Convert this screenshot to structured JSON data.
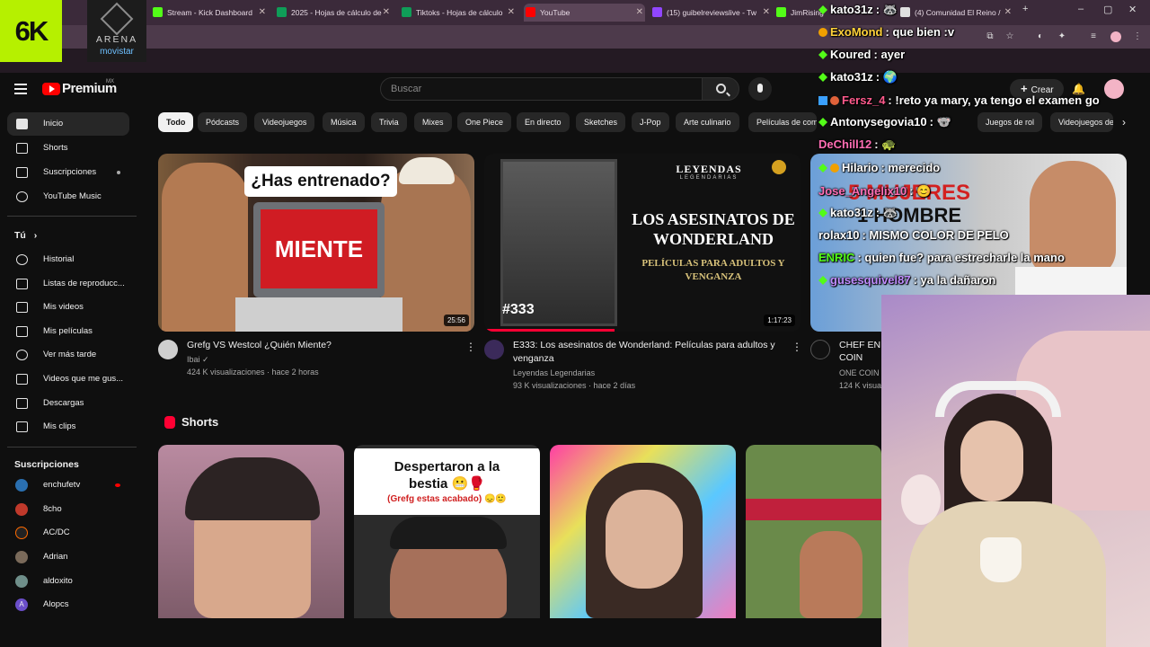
{
  "browser": {
    "tabs": [
      {
        "label": "Stream - Kick Dashboard",
        "color": "#53fc18"
      },
      {
        "label": "2025 - Hojas de cálculo de",
        "color": "#0f9d58"
      },
      {
        "label": "Tiktoks - Hojas de cálculo",
        "color": "#0f9d58"
      },
      {
        "label": "YouTube",
        "color": "#ff0000"
      },
      {
        "label": "(15) guibelreviewslive - Tw",
        "color": "#9146ff"
      },
      {
        "label": "JimRising",
        "color": "#53fc18"
      },
      {
        "label": "(4) Comunidad El Reino /",
        "color": "#e0e0e0"
      }
    ],
    "new_tab": "+",
    "window_controls": [
      "–",
      "▢",
      "✕"
    ]
  },
  "overlay": {
    "logo_6k": "6K",
    "arena_line1": "ARENA",
    "arena_line2": "movistar"
  },
  "masthead": {
    "logo_text": "Premium",
    "country": "MX",
    "search_placeholder": "Buscar",
    "create_label": "Crear"
  },
  "sidebar": {
    "main": [
      {
        "label": "Inicio",
        "icon": "home-icon"
      },
      {
        "label": "Shorts",
        "icon": "shorts-icon"
      },
      {
        "label": "Suscripciones",
        "icon": "subscriptions-icon"
      },
      {
        "label": "YouTube Music",
        "icon": "music-icon"
      }
    ],
    "you_heading": "Tú",
    "you_chevron": "›",
    "you": [
      {
        "label": "Historial",
        "icon": "history-icon"
      },
      {
        "label": "Listas de reproducc...",
        "icon": "playlists-icon"
      },
      {
        "label": "Mis videos",
        "icon": "my-videos-icon"
      },
      {
        "label": "Mis películas",
        "icon": "movies-icon"
      },
      {
        "label": "Ver más tarde",
        "icon": "watch-later-icon"
      },
      {
        "label": "Videos que me gus...",
        "icon": "liked-icon"
      },
      {
        "label": "Descargas",
        "icon": "download-icon"
      },
      {
        "label": "Mis clips",
        "icon": "clips-icon"
      }
    ],
    "subs_heading": "Suscripciones",
    "subs": [
      {
        "label": "enchufetv",
        "color": "#2a6fb0"
      },
      {
        "label": "8cho",
        "color": "#c0392b"
      },
      {
        "label": "AC/DC",
        "color": "#222222"
      },
      {
        "label": "Adrian",
        "color": "#7a6a5a"
      },
      {
        "label": "aldoxito",
        "color": "#6f8f8a"
      },
      {
        "label": "Alopcs",
        "color": "#6a4ec9",
        "initial": "A"
      }
    ]
  },
  "chips": [
    "Todo",
    "Pódcasts",
    "Videojuegos",
    "Música",
    "Trivia",
    "Mixes",
    "One Piece",
    "En directo",
    "Sketches",
    "J-Pop",
    "Arte culinario",
    "Películas de comedia",
    "Juegos de rol",
    "Videojuegos de"
  ],
  "videos": [
    {
      "title": "Grefg VS Westcol ¿Quién Miente?",
      "channel": "Ibai",
      "verified": "✓",
      "stats": "424 K visualizaciones · hace 2 horas",
      "duration": "25:56",
      "thumb_text_top": "¿Has entrenado?",
      "thumb_text_main": "MIENTE"
    },
    {
      "title": "E333: Los asesinatos de Wonderland: Películas para adultos y venganza",
      "channel": "Leyendas Legendarias",
      "stats": "93 K visualizaciones · hace 2 días",
      "duration": "1:17:23",
      "thumb_brand": "LEYENDAS",
      "thumb_brand_sub": "LEGENDARIAS",
      "thumb_title": "LOS ASESINATOS DE WONDERLAND",
      "thumb_sub": "PELÍCULAS PARA ADULTOS Y VENGANZA",
      "thumb_ep": "#333"
    },
    {
      "title": "CHEF EN M",
      "title2": "COIN",
      "channel": "ONE COIN",
      "stats": "124 K visuali",
      "thumb_text1": "5 MUJERES",
      "thumb_text2": "1 HOMBRE"
    }
  ],
  "shorts": {
    "heading": "Shorts",
    "cards": [
      {
        "caption": ""
      },
      {
        "caption_line1": "Despertaron a la",
        "caption_line2": "bestia",
        "caption_line3": "(Grefg estas acabado)"
      },
      {
        "caption": ""
      },
      {
        "caption": ""
      }
    ]
  },
  "chat": [
    {
      "user": "kato31z",
      "msg": ": 🦝",
      "color": "#ffffff"
    },
    {
      "user": "ExoMond",
      "msg": ": que bien :v",
      "color": "#ffd23a"
    },
    {
      "user": "Koured",
      "msg": ": ayer",
      "color": "#ffffff"
    },
    {
      "user": "kato31z",
      "msg": ": 🌍",
      "color": "#ffffff"
    },
    {
      "user": "Fersz_4",
      "msg": ": !reto ya mary, ya tengo el examen go",
      "color": "#ff5a8c"
    },
    {
      "user": "Antonysegovia10",
      "msg": ": 🐨",
      "color": "#ffffff"
    },
    {
      "user": "DeChill12",
      "msg": ": 🐢",
      "color": "#ff6eb4"
    },
    {
      "user": "Hilario",
      "msg": ": merecido",
      "color": "#ffffff"
    },
    {
      "user": "Jose_Angelix10",
      "msg": ": 😊",
      "color": "#ff6eb4"
    },
    {
      "user": "kato31z",
      "msg": ": 🦝",
      "color": "#ffffff"
    },
    {
      "user": "rolax10",
      "msg": ": MISMO COLOR DE PELO",
      "color": "#ffffff"
    },
    {
      "user": "ENRIC",
      "msg": ": quien fue? para estrecharle la mano",
      "color": "#53fc18"
    },
    {
      "user": "gusesquivel87",
      "msg": ": ya la dañaron",
      "color": "#c08cff"
    }
  ]
}
